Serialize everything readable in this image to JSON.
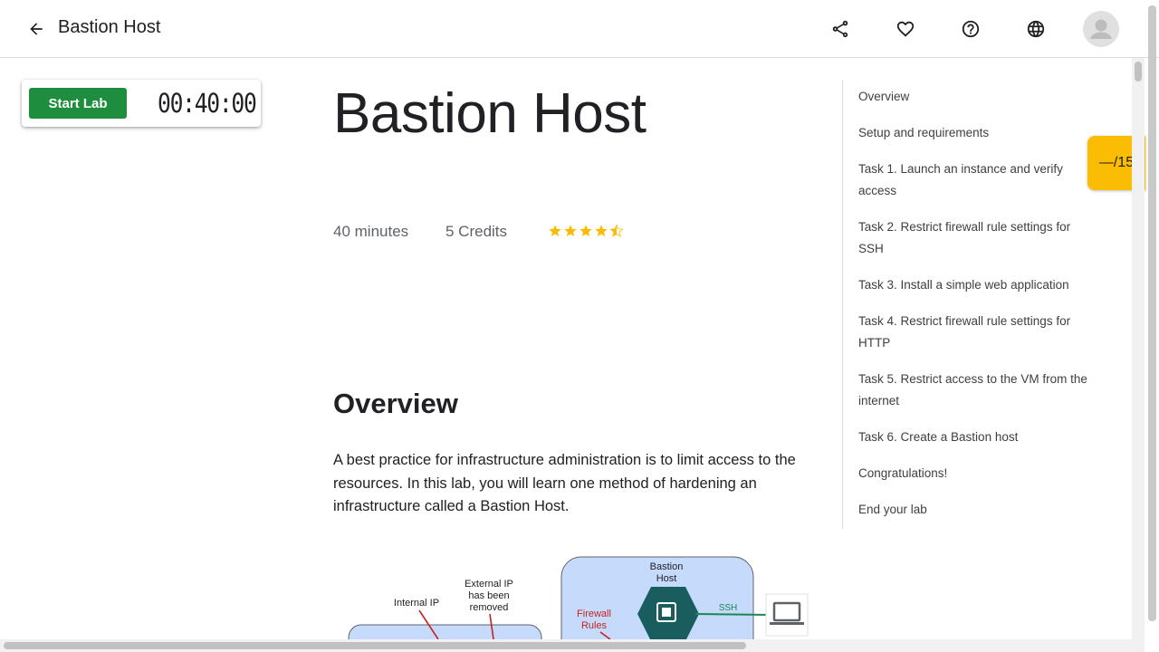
{
  "header": {
    "title": "Bastion Host",
    "icons": [
      "arrow-back-icon",
      "share-icon",
      "heart-icon",
      "help-icon",
      "globe-icon",
      "avatar"
    ]
  },
  "lab": {
    "start_label": "Start Lab",
    "timer": "00:40:00",
    "colors": {
      "start": "#1e8e3e",
      "score": "#fbbc04",
      "stars": "#fbbc04"
    }
  },
  "main": {
    "title": "Bastion Host",
    "duration": "40 minutes",
    "credits": "5 Credits",
    "rating": 4.5,
    "overview_heading": "Overview",
    "overview_text": "A best practice for infrastructure administration is to limit access to the resources. In this lab, you will learn one method of hardening an infrastructure called a Bastion Host."
  },
  "toc": {
    "items": [
      "Overview",
      "Setup and requirements",
      "Task 1. Launch an instance and verify access",
      "Task 2. Restrict firewall rule settings for SSH",
      "Task 3. Install a simple web application",
      "Task 4. Restrict firewall rule settings for HTTP",
      "Task 5. Restrict access to the VM from the internet",
      "Task 6. Create a Bastion host",
      "Congratulations!",
      "End your lab"
    ]
  },
  "score": {
    "label": "—/15"
  },
  "diagram": {
    "internal_ip": "Internal IP",
    "external_ip": "External IP has been removed",
    "bastion_host": "Bastion Host",
    "firewall_rules": "Firewall Rules",
    "ssh": "SSH"
  }
}
